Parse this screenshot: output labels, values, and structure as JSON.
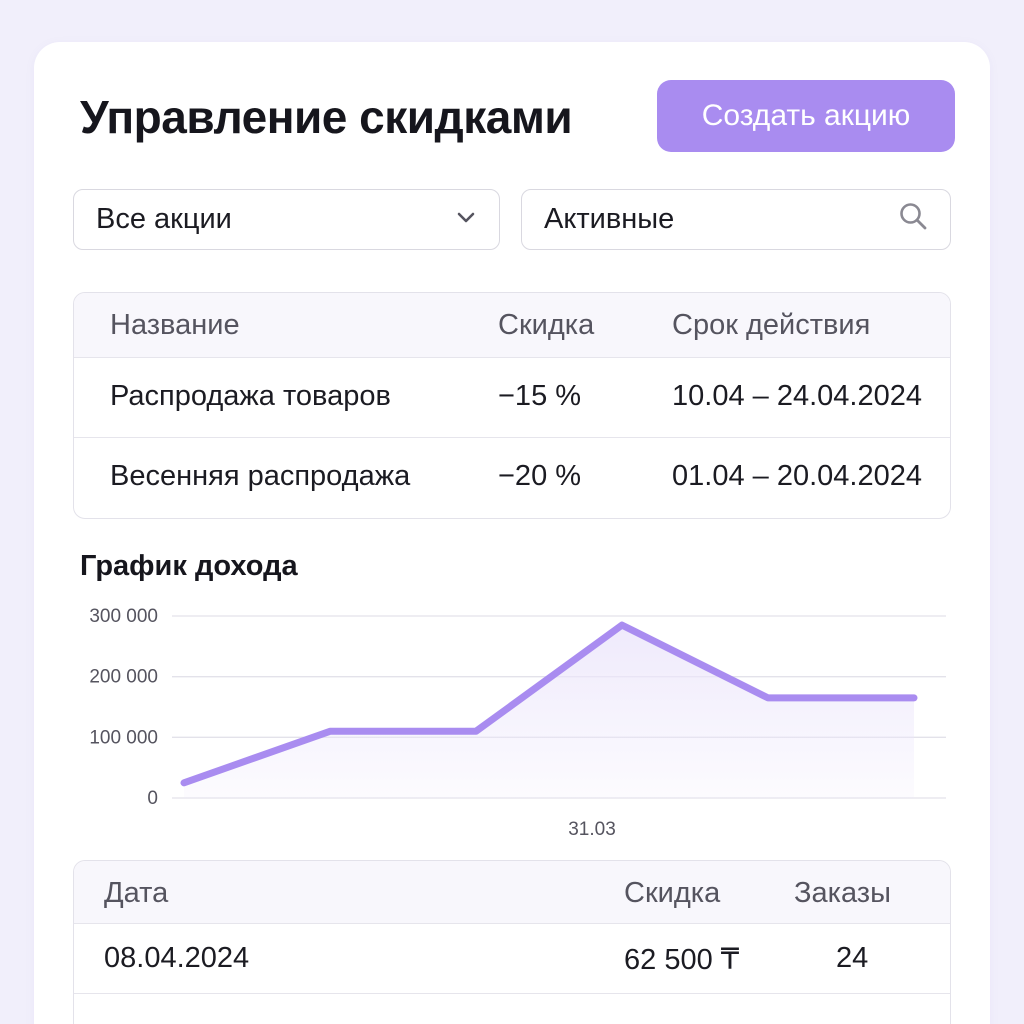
{
  "header": {
    "title": "Управление скидками",
    "create_button": "Создать акцию"
  },
  "filters": {
    "promo_select": {
      "value": "Все акции"
    },
    "status_search": {
      "value": "Активные"
    }
  },
  "promotions_table": {
    "columns": [
      "Название",
      "Скидка",
      "Срок действия"
    ],
    "rows": [
      [
        "Распродажа товаров",
        "−15 %",
        "10.04 – 24.04.2024"
      ],
      [
        "Весенняя распродажа",
        "−20 %",
        "01.04 – 20.04.2024"
      ]
    ]
  },
  "chart": {
    "title": "График дохода"
  },
  "chart_data": {
    "type": "area",
    "title": "График дохода",
    "x_tick_labels": [
      "31.03"
    ],
    "y_tick_labels": [
      "0",
      "100 000",
      "200 000",
      "300 000"
    ],
    "ylim": [
      0,
      300000
    ],
    "grid": true,
    "series": [
      {
        "values": [
          25000,
          110000,
          110000,
          285000,
          165000,
          165000
        ]
      }
    ],
    "colors": {
      "line": "#a98cf0",
      "fill": "#ece6fb",
      "grid": "#e3e2ea"
    }
  },
  "orders_table": {
    "columns": [
      "Дата",
      "Скидка",
      "Заказы"
    ],
    "rows": [
      [
        "08.04.2024",
        "62 500 ₸",
        "24"
      ]
    ]
  },
  "colors": {
    "accent": "#a98cf0",
    "background": "#f1effb"
  }
}
